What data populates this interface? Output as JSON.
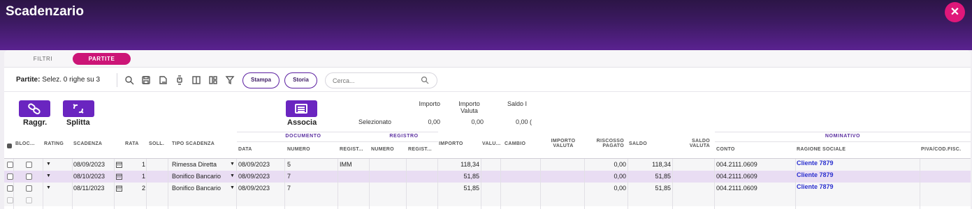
{
  "window": {
    "title": "Scadenzario",
    "close_icon": "close-icon"
  },
  "tabs": [
    {
      "label": "FILTRI"
    },
    {
      "label": "PARTITE",
      "active": true
    }
  ],
  "toolbar": {
    "label": "Partite:",
    "selection_text": "Selez. 0 righe su 3",
    "buttons": {
      "stampa": "Stampa",
      "storia": "Storia"
    },
    "search_placeholder": "Cerca...",
    "icons": [
      "search-icon",
      "save-icon",
      "export-icon",
      "watch-icon",
      "columns-icon",
      "layout-icon",
      "filter-icon"
    ]
  },
  "actions": {
    "raggr": "Raggr.",
    "splitta": "Splitta",
    "associa": "Associa"
  },
  "summary": {
    "row_label": "Selezionato",
    "headers": [
      "Importo",
      "Importo Valuta",
      "Saldo I"
    ],
    "values": [
      "0,00",
      "0,00",
      "0,00 ("
    ]
  },
  "table": {
    "group_headers": {
      "documento": "DOCUMENTO",
      "registro": "REGISTRO",
      "nominativo": "NOMINATIVO"
    },
    "columns": {
      "bloc": "BLOC...",
      "rating": "RATING",
      "scadenza": "SCADENZA",
      "rata": "RATA",
      "soll": "SOLL.",
      "tipo": "TIPO SCADENZA",
      "doc_data": "DATA",
      "doc_numero": "NUMERO",
      "doc_registro": "REGIST...",
      "reg_numero": "NUMERO",
      "reg_registro": "REGIST...",
      "importo": "IMPORTO",
      "valuta": "VALU...",
      "cambio": "CAMBIO",
      "importo_valuta": "IMPORTO VALUTA",
      "riscosso": "RISCOSSO PAGATO",
      "saldo": "SALDO",
      "saldo_valuta": "SALDO VALUTA",
      "conto": "CONTO",
      "ragione_sociale": "RAGIONE SOCIALE",
      "piva": "PIVA/COD.FISC."
    },
    "rows": [
      {
        "scadenza": "08/09/2023",
        "rata": "1",
        "tipo": "Rimessa Diretta",
        "doc_data": "08/09/2023",
        "doc_numero": "5",
        "doc_registro": "IMM",
        "importo": "118,34",
        "riscosso": "0,00",
        "saldo": "118,34",
        "conto": "004.2111.0609",
        "ragione_sociale": "Cliente 7879",
        "selected": false
      },
      {
        "scadenza": "08/10/2023",
        "rata": "1",
        "tipo": "Bonifico Bancario",
        "doc_data": "08/09/2023",
        "doc_numero": "7",
        "doc_registro": "",
        "importo": "51,85",
        "riscosso": "0,00",
        "saldo": "51,85",
        "conto": "004.2111.0609",
        "ragione_sociale": "Cliente 7879",
        "selected": true
      },
      {
        "scadenza": "08/11/2023",
        "rata": "2",
        "tipo": "Bonifico Bancario",
        "doc_data": "08/09/2023",
        "doc_numero": "7",
        "doc_registro": "",
        "importo": "51,85",
        "riscosso": "0,00",
        "saldo": "51,85",
        "conto": "004.2111.0609",
        "ragione_sociale": "Cliente 7879",
        "selected": false
      }
    ]
  }
}
